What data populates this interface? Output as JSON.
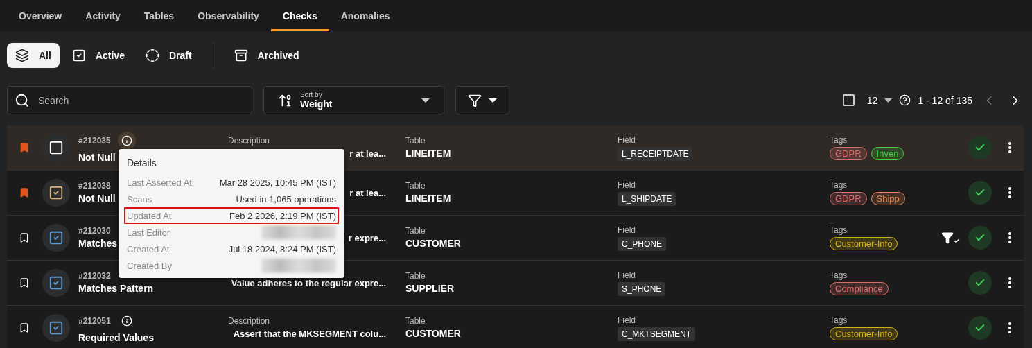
{
  "tabs": [
    {
      "label": "Overview",
      "selected": false
    },
    {
      "label": "Activity",
      "selected": false
    },
    {
      "label": "Tables",
      "selected": false
    },
    {
      "label": "Observability",
      "selected": false
    },
    {
      "label": "Checks",
      "selected": true
    },
    {
      "label": "Anomalies",
      "selected": false
    }
  ],
  "status_filters": [
    {
      "kind": "all",
      "label": "All",
      "selected": true
    },
    {
      "kind": "active",
      "label": "Active",
      "selected": false
    },
    {
      "kind": "draft",
      "label": "Draft",
      "selected": false
    },
    {
      "kind": "archived",
      "label": "Archived",
      "selected": false
    }
  ],
  "search": {
    "placeholder": "Search"
  },
  "sort": {
    "label": "Sort by",
    "value": "Weight"
  },
  "pagination": {
    "select_all_checked": false,
    "page_size": "12",
    "range": "1 - 12 of 135",
    "prev_disabled": true,
    "next_disabled": false
  },
  "rows": [
    {
      "selected": true,
      "bookmarked": true,
      "kind": "empty",
      "id": "#212035",
      "info_icon": true,
      "name": "Not Null",
      "description_label": "Description",
      "description": "r at lea...",
      "table_label": "Table",
      "table": "LINEITEM",
      "field_label": "Field",
      "field": "L_RECEIPTDATE",
      "tags_label": "Tags",
      "tags": [
        {
          "label": "GDPR",
          "color": "#e06c6c"
        },
        {
          "label": "Inven",
          "color": "#3fcf3f"
        }
      ],
      "filter_applied": false
    },
    {
      "selected": false,
      "bookmarked": true,
      "kind": "draft",
      "id": "#212038",
      "info_icon": false,
      "name": "Not Null",
      "description": "r at lea...",
      "table_label": "Table",
      "table": "LINEITEM",
      "field_label": "Field",
      "field": "L_SHIPDATE",
      "tags_label": "Tags",
      "tags": [
        {
          "label": "GDPR",
          "color": "#e06c6c"
        },
        {
          "label": "Shipp",
          "color": "#e8895a"
        }
      ],
      "filter_applied": false
    },
    {
      "selected": false,
      "bookmarked": false,
      "kind": "active",
      "id": "#212030",
      "info_icon": false,
      "name": "Matches",
      "description": "r expre...",
      "table_label": "Table",
      "table": "CUSTOMER",
      "field_label": "Field",
      "field": "C_PHONE",
      "tags_label": "Tags",
      "tags": [
        {
          "label": "Customer-Info",
          "color": "#d4b21a"
        }
      ],
      "filter_applied": true
    },
    {
      "selected": false,
      "bookmarked": false,
      "kind": "active",
      "id": "#212032",
      "info_icon": false,
      "name": "Matches Pattern",
      "description": "Value adheres to the regular expre...",
      "table_label": "Table",
      "table": "SUPPLIER",
      "field_label": "Field",
      "field": "S_PHONE",
      "tags_label": "Tags",
      "tags": [
        {
          "label": "Compliance",
          "color": "#e06c6c"
        }
      ],
      "filter_applied": false
    },
    {
      "selected": false,
      "bookmarked": false,
      "kind": "active",
      "id": "#212051",
      "info_icon": true,
      "name": "Required Values",
      "description_label": "Description",
      "description": "Assert that the MKSEGMENT colu...",
      "table_label": "Table",
      "table": "CUSTOMER",
      "field_label": "Field",
      "field": "C_MKTSEGMENT",
      "tags_label": "Tags",
      "tags": [
        {
          "label": "Customer-Info",
          "color": "#d4b21a"
        }
      ],
      "filter_applied": false
    }
  ],
  "details_popover": {
    "title": "Details",
    "rows": [
      {
        "label": "Last Asserted At",
        "value": "Mar 28 2025, 10:45 PM (IST)",
        "highlighted": false
      },
      {
        "label": "Scans",
        "value": "Used in 1,065 operations",
        "highlighted": false
      },
      {
        "label": "Updated At",
        "value": "Feb 2 2026, 2:19 PM (IST)",
        "highlighted": true
      },
      {
        "label": "Last Editor",
        "redacted": true,
        "highlighted": false
      },
      {
        "label": "Created At",
        "value": "Jul 18 2024, 8:24 PM (IST)",
        "highlighted": false
      },
      {
        "label": "Created By",
        "redacted": true,
        "highlighted": false
      }
    ]
  }
}
